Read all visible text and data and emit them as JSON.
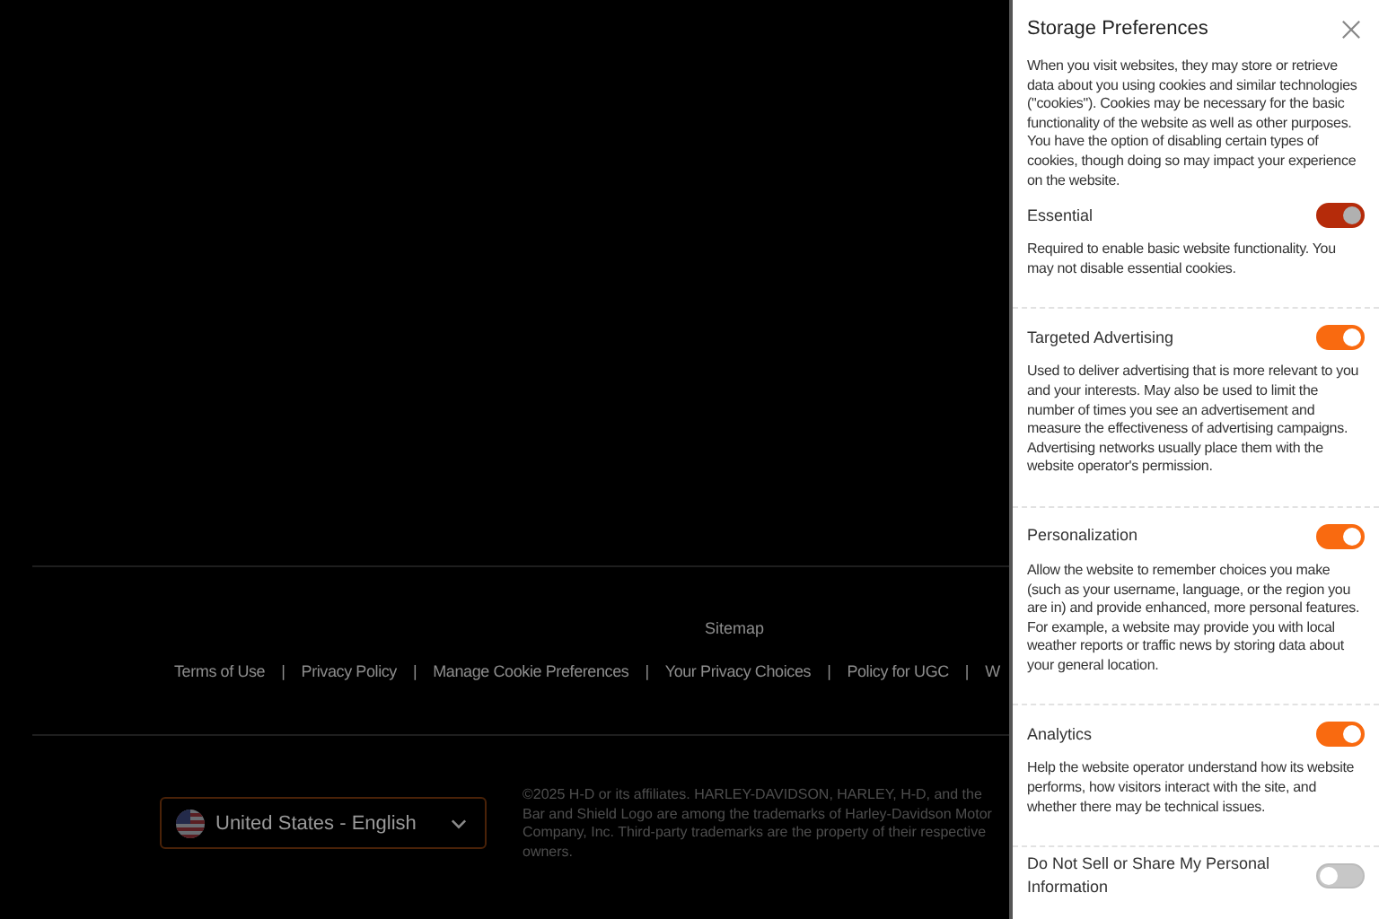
{
  "footer": {
    "sitemap": "Sitemap",
    "separator": "|",
    "links": [
      "Terms of Use",
      "Privacy Policy",
      "Manage Cookie Preferences",
      "Your Privacy Choices",
      "Policy for UGC",
      "W"
    ],
    "region": "United States - English",
    "copyright": "©2025 H-D or its affiliates. HARLEY-DAVIDSON, HARLEY, H-D, and the Bar and Shield Logo are among the trademarks of Harley-Davidson Motor Company, Inc. Third-party trademarks are the property of their respective owners."
  },
  "panel": {
    "title": "Storage Preferences",
    "intro": "When you visit websites, they may store or retrieve data about you using cookies and similar technologies (\"cookies\"). Cookies may be necessary for the basic functionality of the website as well as other purposes. You have the option of disabling certain types of cookies, though doing so may impact your experience on the website.",
    "categories": [
      {
        "name": "Essential",
        "on": true,
        "disabled": true,
        "description": "Required to enable basic website functionality. You may not disable essential cookies."
      },
      {
        "name": "Targeted Advertising",
        "on": true,
        "disabled": false,
        "description": "Used to deliver advertising that is more relevant to you and your interests. May also be used to limit the number of times you see an advertisement and measure the effectiveness of advertising campaigns. Advertising networks usually place them with the website operator's permission."
      },
      {
        "name": "Personalization",
        "on": true,
        "disabled": false,
        "description": "Allow the website to remember choices you make (such as your username, language, or the region you are in) and provide enhanced, more personal features. For example, a website may provide you with local weather reports or traffic news by storing data about your general location."
      },
      {
        "name": "Analytics",
        "on": true,
        "disabled": false,
        "description": "Help the website operator understand how its website performs, how visitors interact with the site, and whether there may be technical issues."
      },
      {
        "name": "Do Not Sell or Share My Personal Information",
        "on": false,
        "disabled": false
      }
    ]
  }
}
